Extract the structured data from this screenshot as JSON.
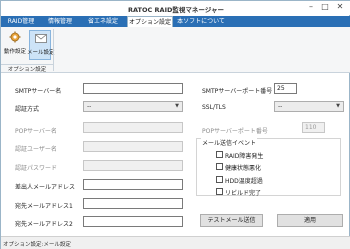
{
  "window": {
    "title": "RATOC RAID監視マネージャー",
    "minimize": "–",
    "maximize": "□",
    "close": "✕"
  },
  "tabs": [
    {
      "label": "RAID管理"
    },
    {
      "label": "情報管理"
    },
    {
      "label": "省エネ設定"
    },
    {
      "label": "オプション設定"
    },
    {
      "label": "本ソフトについて"
    }
  ],
  "ribbon": {
    "buttons": [
      {
        "label": "動作設定",
        "icon": "gear-icon"
      },
      {
        "label": "メール設定",
        "icon": "envelope-icon"
      }
    ],
    "group_label": "オプション設定"
  },
  "form": {
    "smtp_server": {
      "label": "SMTPサーバー名",
      "value": ""
    },
    "auth_method": {
      "label": "認証方式",
      "value": "--"
    },
    "pop_server": {
      "label": "POPサーバー名",
      "value": ""
    },
    "auth_user": {
      "label": "認証ユーザー名",
      "value": ""
    },
    "auth_password": {
      "label": "認証パスワード",
      "value": ""
    },
    "from_address": {
      "label": "差出人メールアドレス",
      "value": ""
    },
    "to_address1": {
      "label": "宛先メールアドレス1",
      "value": ""
    },
    "to_address2": {
      "label": "宛先メールアドレス2",
      "value": ""
    },
    "smtp_port": {
      "label": "SMTPサーバーポート番号",
      "value": "25"
    },
    "ssl_tls": {
      "label": "SSL/TLS",
      "value": "--"
    },
    "pop_port": {
      "label": "POPサーバーポート番号",
      "value": "110"
    }
  },
  "events": {
    "title": "メール送信イベント",
    "items": [
      {
        "label": "RAID障害発生",
        "checked": false
      },
      {
        "label": "健康状態悪化",
        "checked": false
      },
      {
        "label": "HDD温度超過",
        "checked": false
      },
      {
        "label": "リビルド完了",
        "checked": false
      }
    ]
  },
  "buttons": {
    "test_mail": "テストメール送信",
    "apply": "適用"
  },
  "status": {
    "text": "オプション設定:メール設定"
  },
  "colors": {
    "tab_bar": "#2a6fb5",
    "selected_ribbon": "#cde3f7"
  }
}
